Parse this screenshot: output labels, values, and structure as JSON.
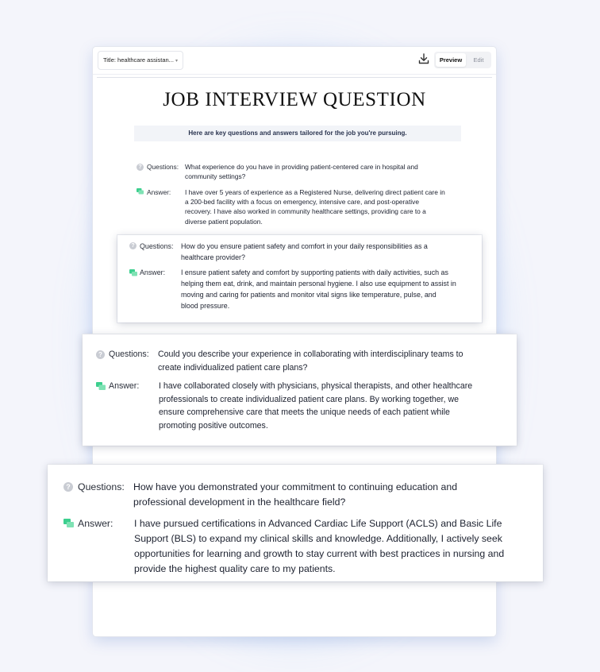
{
  "topbar": {
    "title_select": "Title: healthcare assistan...",
    "tabs": {
      "preview": "Preview",
      "edit": "Edit"
    }
  },
  "document": {
    "heading": "JOB INTERVIEW QUESTION",
    "intro": "Here are key questions and answers tailored for the job you're pursuing.",
    "question_label": "Questions:",
    "answer_label": "Answer:",
    "items": [
      {
        "question": [
          "What experience do you have in providing patient-centered care in hospital and",
          "community settings?"
        ],
        "answer": [
          "I have over 5 years of experience as a Registered Nurse, delivering direct patient care in",
          "a 200-bed facility with a focus on emergency, intensive care, and post-operative",
          "recovery. I have also worked in community healthcare settings, providing care to a",
          "diverse patient population."
        ]
      },
      {
        "question": [
          "How do you ensure patient safety and comfort in your daily responsibilities as a",
          "healthcare provider?"
        ],
        "answer": [
          "I ensure patient safety and comfort by supporting patients with daily activities, such as",
          "helping them eat, drink, and maintain personal hygiene. I also use equipment to assist in",
          "moving and caring for patients and monitor vital signs like temperature, pulse, and",
          "blood pressure."
        ]
      },
      {
        "question": [
          "Could you describe your experience in collaborating with interdisciplinary teams to",
          "create individualized patient care plans?"
        ],
        "answer": [
          "I have collaborated closely with physicians, physical therapists, and other healthcare",
          "professionals to create individualized patient care plans. By working together, we",
          "ensure comprehensive care that meets the unique needs of each patient while",
          "promoting positive outcomes."
        ]
      },
      {
        "question": [
          "How have you demonstrated your commitment to continuing education and",
          "professional development in the healthcare field?"
        ],
        "answer": [
          "I have pursued certifications in Advanced Cardiac Life Support (ACLS) and Basic Life",
          "Support (BLS) to expand my clinical skills and knowledge. Additionally, I actively seek",
          "opportunities for learning and growth to stay current with best practices in nursing and",
          "provide the highest quality care to my patients."
        ]
      }
    ]
  },
  "icons": {
    "download": "download-icon",
    "question": "question-circle-icon",
    "answer": "chat-bubble-icon"
  },
  "colors": {
    "answer_icon": "#3ccf8e",
    "question_icon": "#c9ccd3",
    "glow": "#7fbfff"
  }
}
